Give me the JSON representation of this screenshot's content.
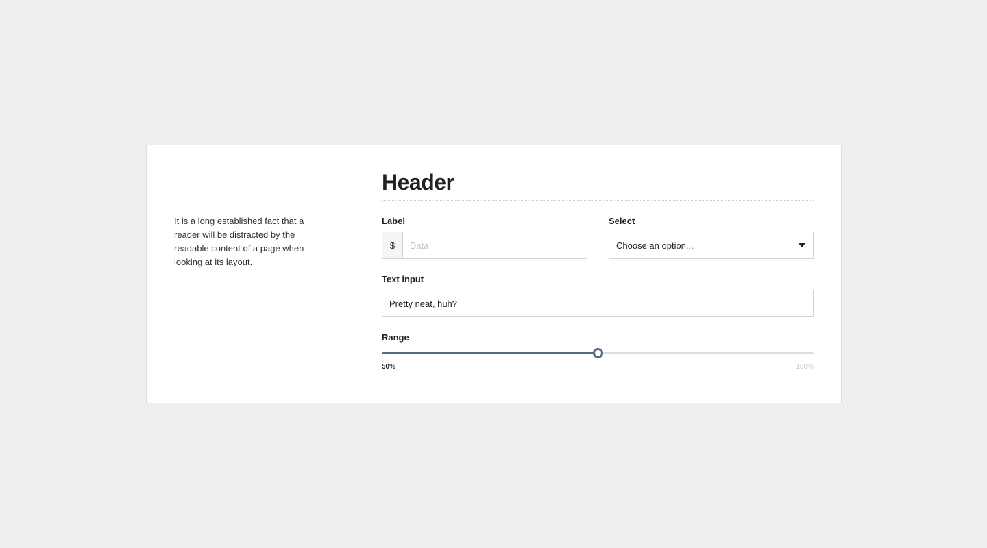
{
  "aside": {
    "text": "It is a long established fact that a reader will be distracted by the readable content of a page when looking at its layout."
  },
  "form": {
    "header": "Header",
    "label_field": {
      "label": "Label",
      "prefix": "$",
      "placeholder": "Data",
      "value": ""
    },
    "select_field": {
      "label": "Select",
      "selected": "Choose an option..."
    },
    "text_field": {
      "label": "Text input",
      "value": "Pretty neat, huh?"
    },
    "range_field": {
      "label": "Range",
      "value_percent": 50,
      "current_label": "50%",
      "max_label": "100%"
    }
  },
  "colors": {
    "accent": "#5a6a85",
    "background": "#eeeeee",
    "card": "#ffffff"
  }
}
